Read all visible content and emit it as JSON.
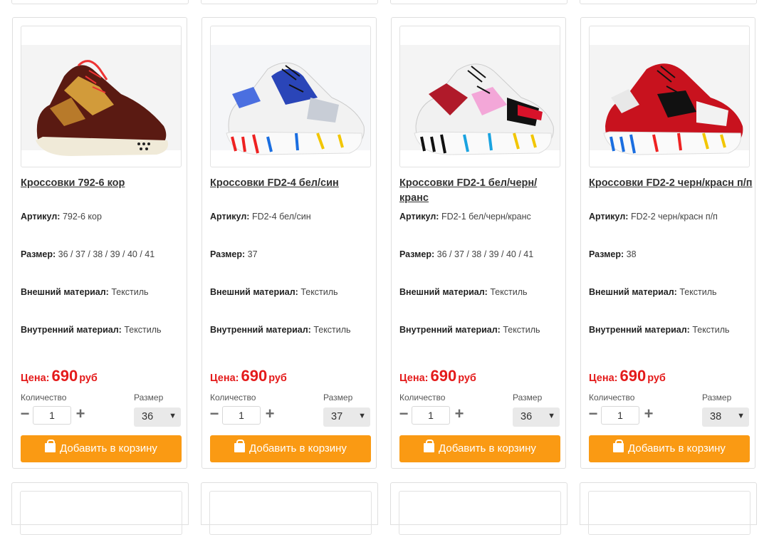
{
  "labels": {
    "article": "Артикул:",
    "size": "Размер:",
    "outer": "Внешний материал:",
    "inner": "Внутренний материал:",
    "price": "Цена:",
    "currency": "руб",
    "quantity": "Количество",
    "size_select": "Размер",
    "add_to_cart": "Добавить в корзину"
  },
  "colors": {
    "accent": "#fa9a13",
    "price": "#e41b1b"
  },
  "products": [
    {
      "title": "Кроссовки 792-6 кор",
      "article": "792-6 кор",
      "sizes": "36 / 37 / 38 / 39 / 40 / 41",
      "outer": "Текстиль",
      "inner": "Текстиль",
      "price": "690",
      "qty": "1",
      "size_selected": "36",
      "image": "leopard-print-sneaker"
    },
    {
      "title": "Кроссовки FD2-4 бел/син",
      "article": "FD2-4 бел/син",
      "sizes": "37",
      "outer": "Текстиль",
      "inner": "Текстиль",
      "price": "690",
      "qty": "1",
      "size_selected": "37",
      "image": "white-blue-sneaker"
    },
    {
      "title": "Кроссовки FD2-1 бел/черн/кранс",
      "article": "FD2-1 бел/черн/кранс",
      "sizes": "36 / 37 / 38 / 39 / 40 / 41",
      "outer": "Текстиль",
      "inner": "Текстиль",
      "price": "690",
      "qty": "1",
      "size_selected": "36",
      "image": "white-black-red-sneaker"
    },
    {
      "title": "Кроссовки FD2-2 черн/красн п/п",
      "article": "FD2-2 черн/красн п/п",
      "sizes": "38",
      "outer": "Текстиль",
      "inner": "Текстиль",
      "price": "690",
      "qty": "1",
      "size_selected": "38",
      "image": "black-red-sneaker"
    }
  ]
}
